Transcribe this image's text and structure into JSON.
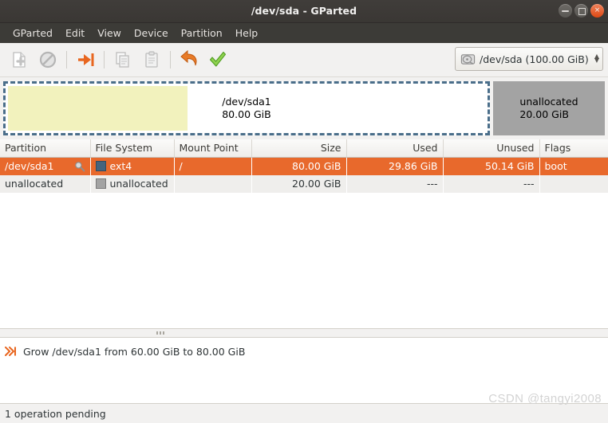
{
  "window": {
    "title": "/dev/sda - GParted",
    "buttons": {
      "minimize": "minimize",
      "maximize": "maximize",
      "close": "×"
    }
  },
  "menubar": {
    "items": [
      {
        "label": "GParted"
      },
      {
        "label": "Edit"
      },
      {
        "label": "View"
      },
      {
        "label": "Device"
      },
      {
        "label": "Partition"
      },
      {
        "label": "Help"
      }
    ]
  },
  "toolbar": {
    "buttons": [
      {
        "name": "new-partition-icon",
        "enabled": false
      },
      {
        "name": "delete-partition-icon",
        "enabled": false
      },
      {
        "name": "resize-move-icon",
        "enabled": true
      },
      {
        "name": "copy-icon",
        "enabled": false
      },
      {
        "name": "paste-icon",
        "enabled": false
      },
      {
        "name": "undo-icon",
        "enabled": true
      },
      {
        "name": "apply-icon",
        "enabled": true
      }
    ],
    "device_selector": {
      "label": "/dev/sda  (100.00 GiB)",
      "icon": "harddisk-icon"
    },
    "annotation": {
      "type": "red-arrow",
      "points_to": "apply-button",
      "color": "#e81414"
    }
  },
  "graphic": {
    "partitions": [
      {
        "name": "/dev/sda1",
        "size": "80.00 GiB",
        "selected": true,
        "used_fraction": 0.373,
        "fill_color": "#f2f2bd",
        "bg_color": "#ffffff",
        "border_color": "#4a6e8a"
      },
      {
        "name": "unallocated",
        "size": "20.00 GiB",
        "selected": false,
        "fill_color": "#a3a3a3"
      }
    ]
  },
  "table": {
    "columns": [
      {
        "label": "Partition",
        "align": "left"
      },
      {
        "label": "File System",
        "align": "left"
      },
      {
        "label": "Mount Point",
        "align": "left"
      },
      {
        "label": "Size",
        "align": "right"
      },
      {
        "label": "Used",
        "align": "right"
      },
      {
        "label": "Unused",
        "align": "right"
      },
      {
        "label": "Flags",
        "align": "left"
      }
    ],
    "rows": [
      {
        "partition": "/dev/sda1",
        "icon": "magnifier-key-icon",
        "filesystem": "ext4",
        "fs_color": "#46647e",
        "mount_point": "/",
        "size": "80.00 GiB",
        "used": "29.86 GiB",
        "unused": "50.14 GiB",
        "flags": "boot",
        "selected": true
      },
      {
        "partition": "unallocated",
        "icon": "",
        "filesystem": "unallocated",
        "fs_color": "#a3a3a3",
        "mount_point": "",
        "size": "20.00 GiB",
        "used": "---",
        "unused": "---",
        "flags": "",
        "selected": false
      }
    ]
  },
  "operations": {
    "items": [
      {
        "icon": "resize-grow-icon",
        "text": "Grow /dev/sda1 from 60.00 GiB to 80.00 GiB"
      }
    ]
  },
  "statusbar": {
    "text": "1 operation pending"
  },
  "watermark": {
    "text": "CSDN @tangyi2008"
  }
}
